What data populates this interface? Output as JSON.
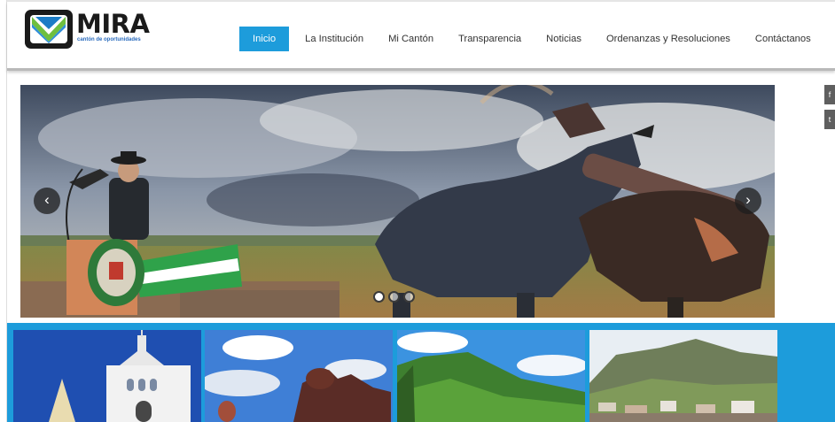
{
  "brand": {
    "name": "MIRA",
    "tagline": "cantón de oportunidades",
    "accent": "#1d9cdb"
  },
  "nav": {
    "items": [
      {
        "label": "Inicio",
        "active": true
      },
      {
        "label": "La Institución",
        "active": false
      },
      {
        "label": "Mi Cantón",
        "active": false
      },
      {
        "label": "Transparencia",
        "active": false
      },
      {
        "label": "Noticias",
        "active": false
      },
      {
        "label": "Ordenanzas y Resoluciones",
        "active": false
      },
      {
        "label": "Contáctanos",
        "active": false
      }
    ]
  },
  "slider": {
    "prev_icon": "chevron-left-icon",
    "next_icon": "chevron-right-icon",
    "prev_glyph": "‹",
    "next_glyph": "›",
    "dots": [
      {
        "active": true
      },
      {
        "active": false
      },
      {
        "active": false
      }
    ]
  },
  "social": [
    {
      "icon": "facebook-icon",
      "glyph": "f"
    },
    {
      "icon": "twitter-icon",
      "glyph": "t"
    }
  ],
  "gallery": [
    {
      "subject": "church"
    },
    {
      "subject": "bull-sculpture"
    },
    {
      "subject": "green-mountains"
    },
    {
      "subject": "valley-town"
    }
  ]
}
